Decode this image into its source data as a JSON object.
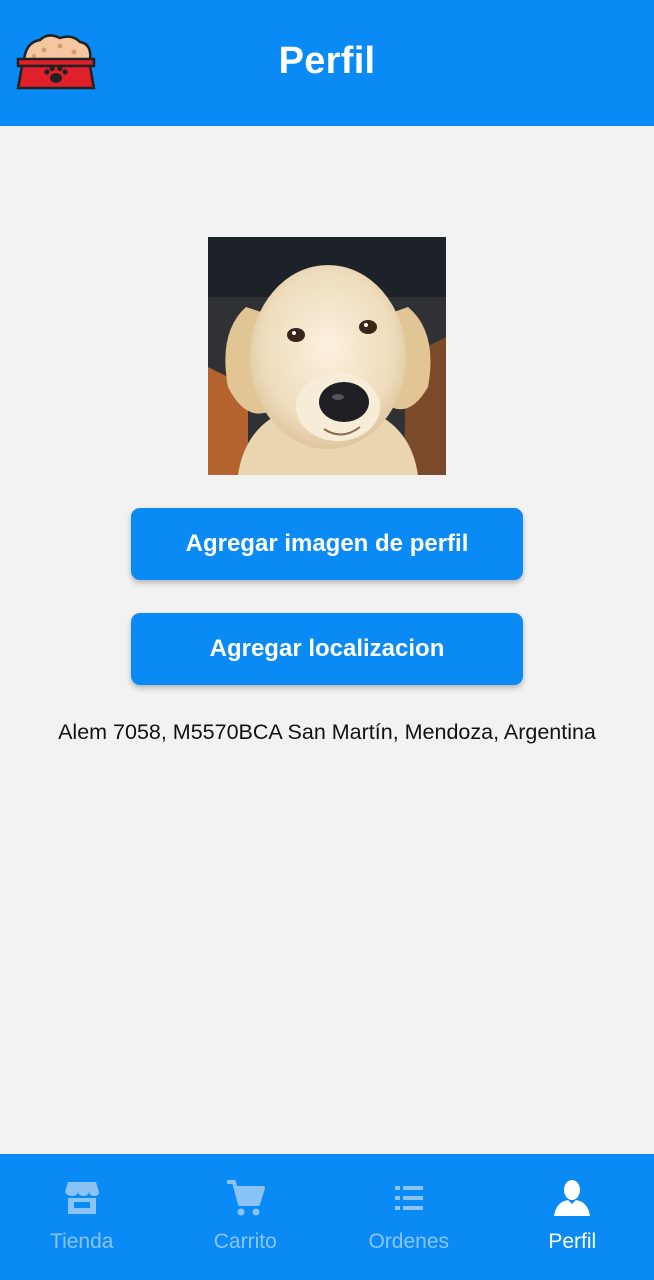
{
  "header": {
    "title": "Perfil",
    "logo_icon": "pet-food-bowl-icon"
  },
  "profile": {
    "photo_alt": "dog",
    "add_image_label": "Agregar imagen de perfil",
    "add_location_label": "Agregar localizacion",
    "address": "Alem 7058, M5570BCA San Martín, Mendoza, Argentina"
  },
  "tabs": [
    {
      "label": "Tienda",
      "icon": "store-icon",
      "active": false
    },
    {
      "label": "Carrito",
      "icon": "cart-icon",
      "active": false
    },
    {
      "label": "Ordenes",
      "icon": "list-icon",
      "active": false
    },
    {
      "label": "Perfil",
      "icon": "user-icon",
      "active": true
    }
  ],
  "colors": {
    "primary": "#0a8af5",
    "background": "#f2f2f2",
    "tab_inactive": "#8cc3f7",
    "tab_active": "#ffffff",
    "logo_bowl": "#e0202a",
    "logo_food": "#f4c7a1"
  }
}
